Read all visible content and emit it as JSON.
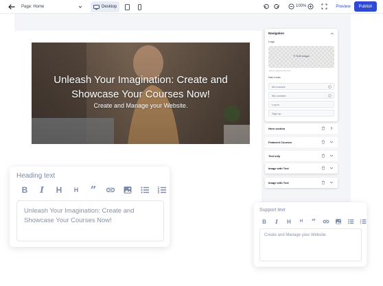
{
  "topbar": {
    "page_select": "Page: Home",
    "device_desktop": "Desktop",
    "zoom": "100%",
    "preview_label": "Preview",
    "publish_label": "Publish"
  },
  "hero": {
    "title": "Unleash Your Imagination: Create and Showcase Your Courses Now!",
    "subtitle": "Create and Manage your Website."
  },
  "panel": {
    "navigation": {
      "title": "Navigation",
      "logo_label": "Logo",
      "edit_image": "Edit image",
      "logo_hint": ".png or .jpeg format only",
      "nav_links_label": "Nav Links",
      "links": [
        "All courses",
        "My courses",
        "Log in",
        "Sign up"
      ]
    },
    "sections": [
      "Hero section",
      "Featured Courses",
      "Text only",
      "Image with Text",
      "Image with Text"
    ]
  },
  "heading_card": {
    "title": "Heading text",
    "text": "Unleash Your Imagination: Create and Showcase Your Courses Now!"
  },
  "support_card": {
    "title": "Support text",
    "text": "Create and Manage your Website."
  },
  "colors": {
    "accent": "#2f49d1",
    "muted_text": "#7a8aa8"
  }
}
